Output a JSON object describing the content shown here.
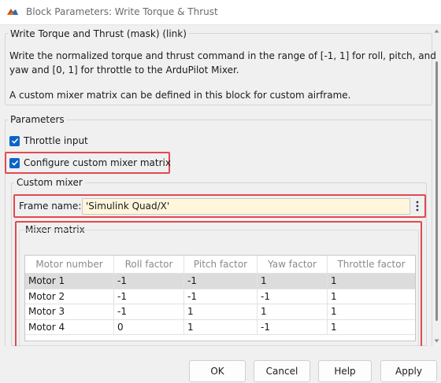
{
  "window": {
    "title": "Block Parameters: Write Torque & Thrust"
  },
  "mask": {
    "header": "Write Torque and Thrust (mask) (link)",
    "description_lines": [
      "Write the normalized torque and thrust command in the range of [-1, 1] for roll, pitch, and",
      "yaw and [0, 1] for throttle to the ArduPilot Mixer.",
      "A custom mixer matrix can be defined in this block for custom airframe."
    ]
  },
  "parameters": {
    "header": "Parameters",
    "throttle_input": {
      "label": "Throttle input",
      "checked": true
    },
    "configure_custom_mixer": {
      "label": "Configure custom mixer matrix",
      "checked": true
    }
  },
  "custom_mixer": {
    "header": "Custom mixer",
    "frame_name_label": "Frame name:",
    "frame_name_value": "'Simulink Quad/X'",
    "mixer_matrix_header": "Mixer matrix",
    "columns": [
      "Motor number",
      "Roll factor",
      "Pitch factor",
      "Yaw factor",
      "Throttle factor"
    ],
    "rows": [
      [
        "Motor 1",
        "-1",
        "-1",
        "1",
        "1"
      ],
      [
        "Motor 2",
        "-1",
        "-1",
        "-1",
        "1"
      ],
      [
        "Motor 3",
        "-1",
        "1",
        "1",
        "1"
      ],
      [
        "Motor 4",
        "0",
        "1",
        "-1",
        "1"
      ]
    ],
    "selected_row": 0
  },
  "buttons": {
    "ok": "OK",
    "cancel": "Cancel",
    "help": "Help",
    "apply": "Apply"
  },
  "colors": {
    "highlight": "#e04a4f",
    "checkbox": "#0a64c8",
    "input_bg": "#fff6dc"
  },
  "icons": [
    "simulink-app-icon",
    "checkmark-icon",
    "more-options-icon",
    "scroll-up-arrow-icon",
    "scroll-down-arrow-icon"
  ]
}
